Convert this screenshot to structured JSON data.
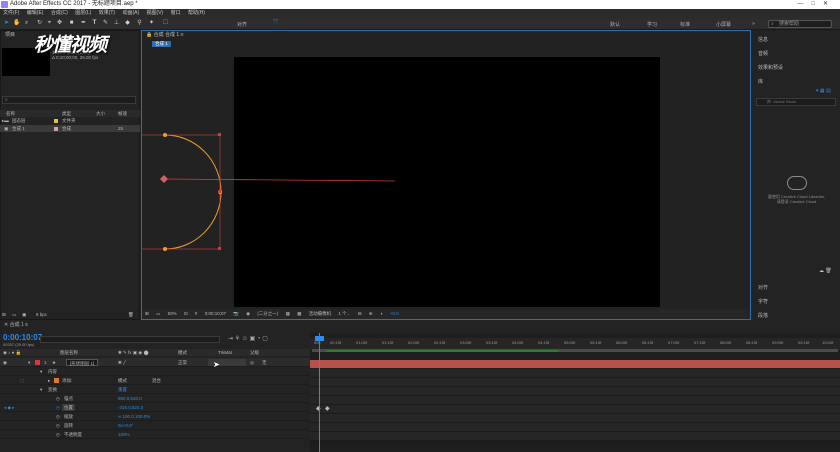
{
  "window": {
    "title": "Adobe After Effects CC 2017 - 无标题项目.aep *"
  },
  "menu": [
    "文件(F)",
    "编辑(E)",
    "合成(C)",
    "图层(L)",
    "效果(T)",
    "动画(A)",
    "视图(V)",
    "窗口",
    "帮助(H)"
  ],
  "toolbar": {
    "snap_label": "对齐",
    "workspaces": [
      "默认",
      "学习",
      "标准",
      "小屏幕"
    ],
    "search_placeholder": "搜索帮助"
  },
  "watermark": "秒懂视频",
  "project": {
    "tab": "项目",
    "info_size": "1920 x 1080 (1.00)",
    "info_duration": "Δ 0;10;00;00, 25.00 fps",
    "columns": [
      "名称",
      "类型",
      "大小",
      "帧速"
    ],
    "rows": [
      {
        "name": "固态层",
        "type": "文件夹",
        "size": "",
        "fps": ""
      },
      {
        "name": "合成 1",
        "type": "合成",
        "size": "",
        "fps": "25"
      }
    ],
    "bpc": "8 bpc"
  },
  "composition": {
    "tab": "合成 合成 1",
    "subtab": "合成 1",
    "zoom": "50%",
    "timecode": "0;00;10;07",
    "resolution": "(二分之一)",
    "camera": "活动摄像机",
    "views": "1 个...",
    "exposure": "+0.0"
  },
  "right_panel": {
    "items": [
      "信息",
      "音频",
      "效果和预设",
      "库"
    ],
    "lib_search": "库: Adobe Stock",
    "cc_line1": "要使用 Creative Cloud Libraries,",
    "cc_line2": "请登录 Creative Cloud",
    "bottom_items": [
      "对齐",
      "字符",
      "段落"
    ]
  },
  "timeline": {
    "tab": "合成 1",
    "timecode": "0:00:10:07",
    "timecode_sub": "00257 (25.00 fps)",
    "columns": [
      "图层名称",
      "模式",
      "TrkMat",
      "父级"
    ],
    "layer": {
      "index": "1",
      "name": "[形状图层 1]",
      "mode": "正常",
      "parent": "无"
    },
    "contents": "内容",
    "add_label": "添加:",
    "add_mode": "模式",
    "blend_label": "混合",
    "transform": "变换",
    "transform_reset": "重置",
    "props": [
      {
        "name": "锚点",
        "value": "960.0,540.0"
      },
      {
        "name": "位置",
        "value": "-316.0,524.0"
      },
      {
        "name": "缩放",
        "value": "∞ 100.0,100.0%"
      },
      {
        "name": "旋转",
        "value": "0x+0.0°"
      },
      {
        "name": "不透明度",
        "value": "100%"
      }
    ],
    "ruler": [
      "00s",
      "00:15f",
      "01:00f",
      "01:15f",
      "02:00f",
      "02:15f",
      "03:00f",
      "03:15f",
      "04:00f",
      "04:15f",
      "05:00f",
      "05:15f",
      "06:00f",
      "06:15f",
      "07:00f",
      "07:15f",
      "08:00f",
      "08:15f",
      "09:00f",
      "09:15f",
      "10:00f"
    ]
  },
  "colors": {
    "accent": "#2d8ceb",
    "layer_bar": "#b5504a",
    "shape_stroke": "#f0a030",
    "path": "#d23c3c"
  }
}
